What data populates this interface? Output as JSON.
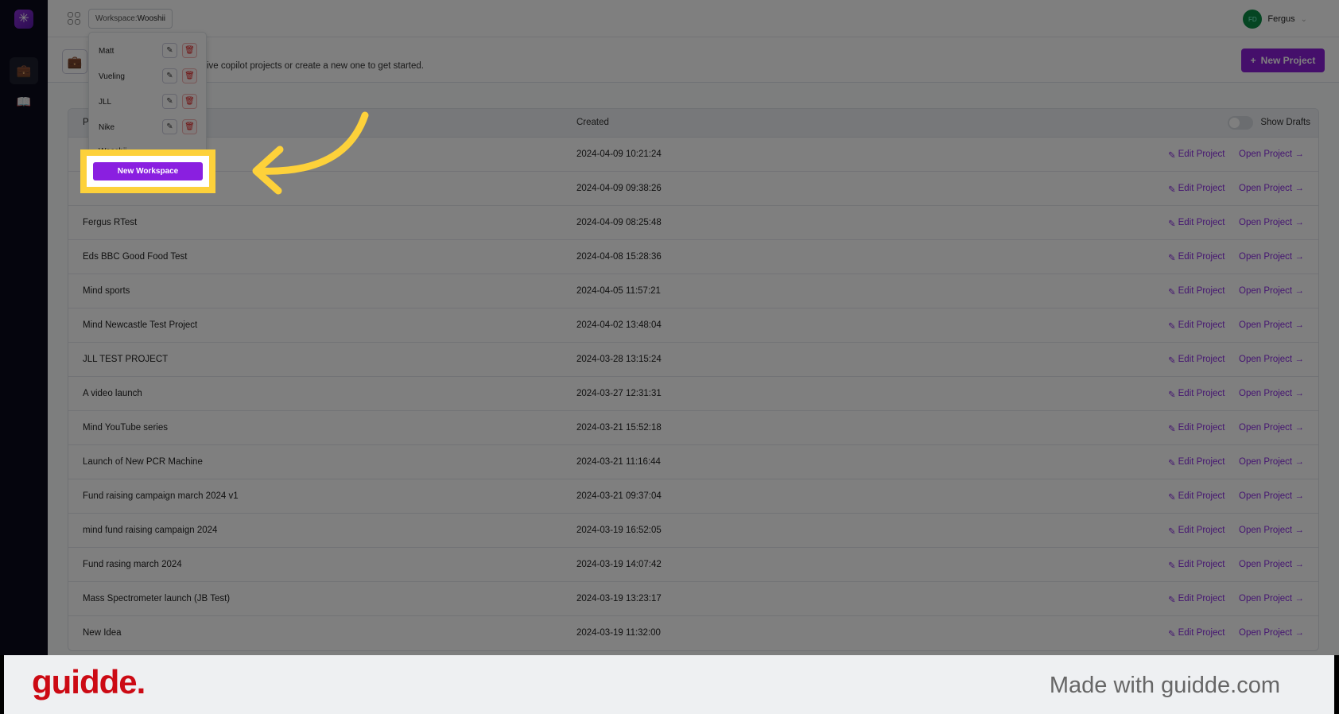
{
  "topbar": {
    "workspace_prefix": "Workspace:",
    "workspace_name": "Wooshii",
    "user_initials": "FD",
    "user_name": "Fergus"
  },
  "subheader": {
    "subtitle_partial": "ive copilot projects or create a new one to get started.",
    "new_project_label": "New Project"
  },
  "table": {
    "header_partial": "P",
    "created_header": "Created",
    "show_drafts_label": "Show Drafts",
    "show_drafts_on": false,
    "edit_label": "Edit Project",
    "open_label": "Open Project →",
    "rows": [
      {
        "name": "",
        "created": "2024-04-09 10:21:24"
      },
      {
        "name": "",
        "created": "2024-04-09 09:38:26"
      },
      {
        "name": "Fergus RTest",
        "created": "2024-04-09 08:25:48"
      },
      {
        "name": "Eds BBC Good Food Test",
        "created": "2024-04-08 15:28:36"
      },
      {
        "name": "Mind sports",
        "created": "2024-04-05 11:57:21"
      },
      {
        "name": "Mind Newcastle Test Project",
        "created": "2024-04-02 13:48:04"
      },
      {
        "name": "JLL TEST PROJECT",
        "created": "2024-03-28 13:15:24"
      },
      {
        "name": "A video launch",
        "created": "2024-03-27 12:31:31"
      },
      {
        "name": "Mind YouTube series",
        "created": "2024-03-21 15:52:18"
      },
      {
        "name": "Launch of New PCR Machine",
        "created": "2024-03-21 11:16:44"
      },
      {
        "name": "Fund raising campaign march 2024 v1",
        "created": "2024-03-21 09:37:04"
      },
      {
        "name": "mind fund raising campaign 2024",
        "created": "2024-03-19 16:52:05"
      },
      {
        "name": "Fund rasing march 2024",
        "created": "2024-03-19 14:07:42"
      },
      {
        "name": "Mass Spectrometer launch (JB Test)",
        "created": "2024-03-19 13:23:17"
      },
      {
        "name": "New Idea",
        "created": "2024-03-19 11:32:00"
      }
    ]
  },
  "dropdown": {
    "items": [
      "Matt",
      "Vueling",
      "JLL",
      "Nike"
    ],
    "current": "Wooshii",
    "new_workspace_label": "New Workspace"
  },
  "footer": {
    "logo": "guidde.",
    "made_with": "Made with guidde.com"
  },
  "colors": {
    "accent": "#8a1fe0",
    "highlight": "#fdd13a",
    "guidde_red": "#cc0a14"
  }
}
